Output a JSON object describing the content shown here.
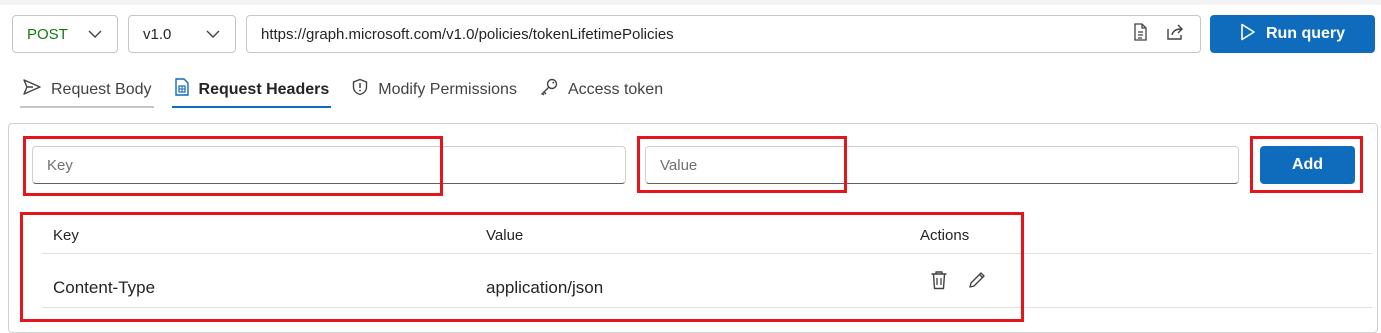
{
  "query": {
    "method": "POST",
    "version": "v1.0",
    "url": "https://graph.microsoft.com/v1.0/policies/tokenLifetimePolicies",
    "run_label": "Run query"
  },
  "tabs": [
    {
      "label": "Request Body",
      "icon": "send-icon"
    },
    {
      "label": "Request Headers",
      "icon": "document-table-icon",
      "active": true
    },
    {
      "label": "Modify Permissions",
      "icon": "shield-icon"
    },
    {
      "label": "Access token",
      "icon": "key-icon"
    }
  ],
  "headers_form": {
    "key_placeholder": "Key",
    "value_placeholder": "Value",
    "add_label": "Add"
  },
  "headers_table": {
    "columns": [
      "Key",
      "Value",
      "Actions"
    ],
    "rows": [
      {
        "key": "Content-Type",
        "value": "application/json"
      }
    ]
  },
  "colors": {
    "accent": "#0f6cbd",
    "method_post": "#107c10",
    "highlight": "#e4151b"
  }
}
